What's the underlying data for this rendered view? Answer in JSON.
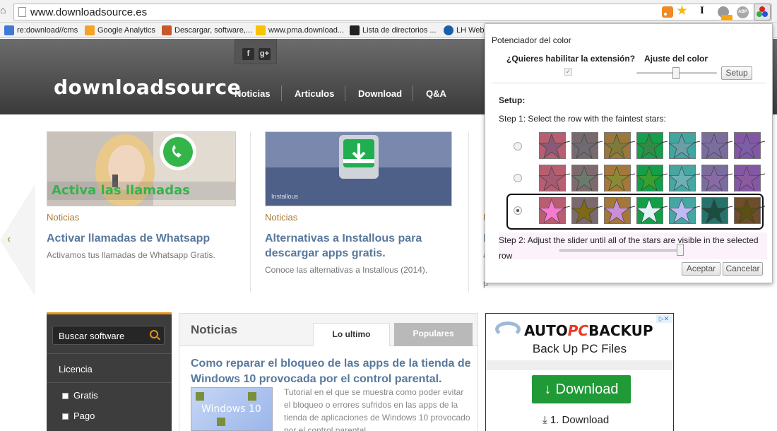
{
  "browser": {
    "url": "www.downloadsource.es",
    "bookmarks": [
      {
        "label": "re:download//cms"
      },
      {
        "label": "Google Analytics"
      },
      {
        "label": "Descargar, software,..."
      },
      {
        "label": "www.pma.download..."
      },
      {
        "label": "Lista de directorios ..."
      },
      {
        "label": "LH WebM"
      }
    ],
    "icons": {
      "home": "home-icon",
      "page": "page-icon",
      "rss": "rss-icon",
      "bookmark": "star-icon",
      "extensions": [
        "instapaper-icon",
        "notification-gear-icon",
        "adblock-plus-icon",
        "color-enhancer-icon"
      ]
    },
    "abp_label": "ABP"
  },
  "site": {
    "logo_text": "downloadsource",
    "social": {
      "facebook": "f",
      "google": "g+"
    },
    "nav": [
      "Noticias",
      "Articulos",
      "Download",
      "Q&A"
    ],
    "cards": [
      {
        "category": "Noticias",
        "title": "Activar llamadas de Whatsapp",
        "description": "Activamos tus llamadas de Whatsapp Gratis.",
        "image_caption": "Activa las llamadas"
      },
      {
        "category": "Noticias",
        "title": "Alternativas a Installous para descargar apps gratis.",
        "description": "Conoce las alternativas a Installous (2014).",
        "image_caption": "Installous"
      },
      {
        "category": "N",
        "title": "L",
        "description": "a",
        "description2": "p"
      }
    ],
    "sidebar": {
      "search_label": "Buscar software",
      "license_heading": "Licencia",
      "options": [
        "Gratis",
        "Pago"
      ]
    },
    "news": {
      "title": "Noticias",
      "tabs": [
        "Lo ultimo",
        "Populares"
      ],
      "article_title": "Como reparar el bloqueo de las apps de la tienda de Windows 10 provocada por el control parental.",
      "thumb_text": "Windows 10",
      "article_desc": "Tutorial en el que se muestra como poder evitar el bloqueo o errores sufridos en las apps de la tienda de aplicaciones de Windows 10 provocado por el control parental."
    },
    "ad": {
      "brand_prefix": "AUTO",
      "brand_mid": "PC",
      "brand_suffix": "BACKUP",
      "subtitle": "Back Up PC Files",
      "button_label": "Download",
      "step_label": "1. Download",
      "adchoice": "▷✕"
    }
  },
  "popup": {
    "title": "Potenciador del color",
    "question": "¿Quieres habilitar la extensión?",
    "adjust_label": "Ajuste del color",
    "enabled": true,
    "setup_button": "Setup",
    "setup_label": "Setup:",
    "step1": "Step 1: Select the row with the faintest stars:",
    "step2": "Step 2: Adjust the slider until all of the stars are visible in the selected row",
    "accept_button": "Aceptar",
    "cancel_button": "Cancelar",
    "selected_row": 2,
    "rows": [
      {
        "bg": [
          "#b75f70",
          "#776a6e",
          "#9b783a",
          "#14a04a",
          "#41a5a0",
          "#7c6c9e",
          "#8457a6"
        ],
        "star": [
          "#8a5a76",
          "#6e6a71",
          "#7d7a3a",
          "#338a44",
          "#6a9fa6",
          "#7a6e9c",
          "#7c5ea4"
        ]
      },
      {
        "bg": [
          "#b75f70",
          "#7e6a6e",
          "#a3783a",
          "#139e4a",
          "#45a6a2",
          "#7b6c9e",
          "#8457a6"
        ],
        "star": [
          "#a35b74",
          "#6c7a6c",
          "#8a8a34",
          "#3a9f2e",
          "#6cb0b4",
          "#8a6aa4",
          "#8c5aa0"
        ]
      },
      {
        "bg": [
          "#b75f70",
          "#7a6a6e",
          "#a3783a",
          "#139e4a",
          "#45a6a2",
          "#26716a",
          "#6d4d2a"
        ],
        "star": [
          "#f57ad0",
          "#7e6a14",
          "#c98fd6",
          "#dff3f5",
          "#bfbaf5",
          "#1b4d40",
          "#5a5014"
        ]
      }
    ]
  }
}
